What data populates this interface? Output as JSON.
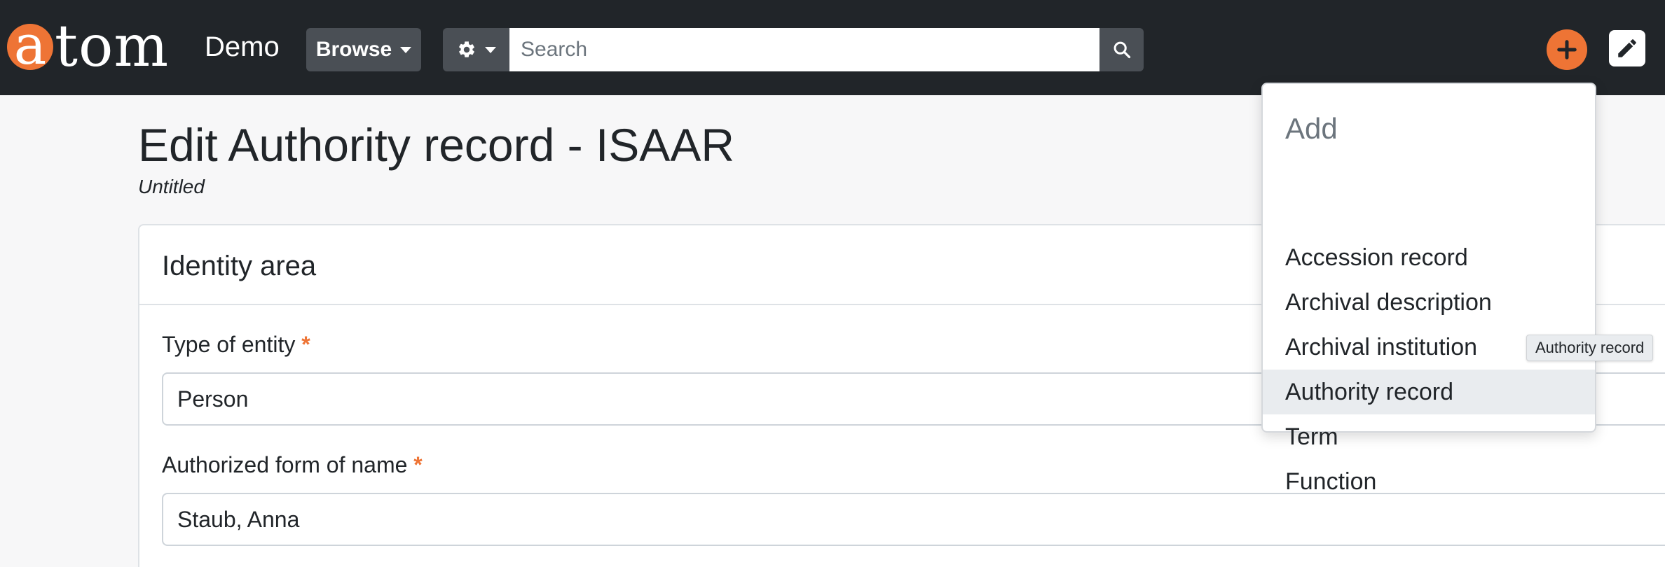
{
  "header": {
    "logo_first": "a",
    "logo_rest": "tom",
    "site_name": "Demo",
    "browse_label": "Browse",
    "search_placeholder": "Search",
    "accent_color": "#ee7435"
  },
  "page": {
    "title": "Edit Authority record - ISAAR",
    "subtitle": "Untitled"
  },
  "identity_area": {
    "title": "Identity area",
    "fields": [
      {
        "label": "Type of entity",
        "required_mark": "*",
        "value": "Person"
      },
      {
        "label": "Authorized form of name",
        "required_mark": "*",
        "value": "Staub, Anna"
      }
    ]
  },
  "add_menu": {
    "header": "Add",
    "items": [
      {
        "label": "Accession record"
      },
      {
        "label": "Archival description"
      },
      {
        "label": "Archival institution"
      },
      {
        "label": "Authority record"
      },
      {
        "label": "Term"
      },
      {
        "label": "Function"
      }
    ],
    "hovered_index": 3
  },
  "tooltip": "Authority record",
  "icons": [
    "gear-icon",
    "search-icon",
    "plus-icon",
    "pencil-icon",
    "caret-down-icon"
  ]
}
